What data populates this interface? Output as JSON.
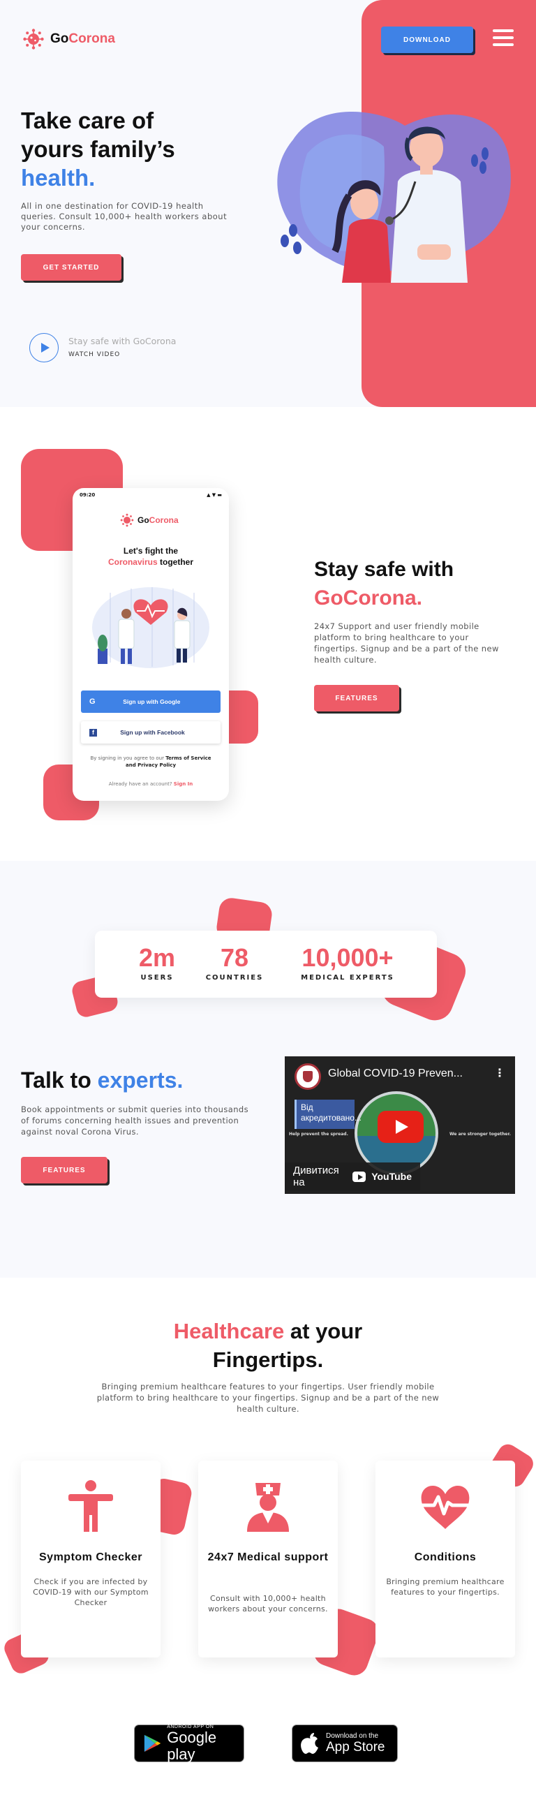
{
  "brand": {
    "go": "Go",
    "corona": "Corona"
  },
  "header": {
    "download_label": "DOWNLOAD"
  },
  "hero": {
    "title_line1": "Take care of",
    "title_line2": "yours family’s",
    "title_highlight": "health.",
    "description": "All in one destination for COVID-19 health queries. Consult 10,000+ health workers about your concerns.",
    "cta_label": "GET STARTED",
    "video_caption": "Stay safe with GoCorona",
    "video_label": "WATCH VIDEO"
  },
  "phone": {
    "time": "09:20",
    "heading_line1": "Let's fight the",
    "heading_red": "Coronavirus",
    "heading_rest": " together",
    "google_label": "Sign up with Google",
    "facebook_label": "Sign up with Facebook",
    "terms_prefix": "By signing in you agree to our ",
    "terms_bold": "Terms of Service and Privacy Policy",
    "signin_prefix": "Already have an account? ",
    "signin_link": "Sign In"
  },
  "section_safe": {
    "title_line1": "Stay safe with",
    "title_highlight": "GoCorona.",
    "description": "24x7 Support and user friendly mobile platform to bring healthcare to your fingertips. Signup and be a part of the new health culture.",
    "cta_label": "FEATURES"
  },
  "stats": [
    {
      "value": "2m",
      "label": "USERS"
    },
    {
      "value": "78",
      "label": "COUNTRIES"
    },
    {
      "value": "10,000+",
      "label": "MEDICAL EXPERTS"
    }
  ],
  "section_experts": {
    "title_prefix": "Talk to ",
    "title_highlight": "experts.",
    "description": "Book appointments or submit queries into thousands of forums concerning health issues and prevention against noval Corona Virus.",
    "cta_label": "FEATURES"
  },
  "video": {
    "title": "Global COVID-19 Preven...",
    "panel_text": "Від акредитовано...",
    "left_small": "Help prevent the spread.",
    "right_small": "We are stronger together.",
    "watch_on": "Дивитися на",
    "youtube": "YouTube"
  },
  "section_features": {
    "title_highlight": "Healthcare",
    "title_rest": " at your",
    "title_line2": "Fingertips.",
    "description": "Bringing premium healthcare features to your fingertips. User friendly mobile platform to bring healthcare to your fingertips. Signup and be a part of the new health culture.",
    "cards": [
      {
        "title": "Symptom Checker",
        "text": "Check if you are infected by COVID-19 with our Symptom Checker",
        "icon": "person-icon"
      },
      {
        "title": "24x7 Medical support",
        "text": "Consult with 10,000+ health workers about your concerns.",
        "icon": "nurse-icon"
      },
      {
        "title": "Conditions",
        "text": "Bringing premium healthcare features to your fingertips.",
        "icon": "heartbeat-icon"
      }
    ]
  },
  "stores": {
    "google_small": "ANDROID APP ON",
    "google_big": "Google play",
    "apple_small": "Download on the",
    "apple_big": "App Store"
  },
  "colors": {
    "accent_red": "#ee5b67",
    "accent_blue": "#3f82e6",
    "background": "#f8f9fd"
  }
}
